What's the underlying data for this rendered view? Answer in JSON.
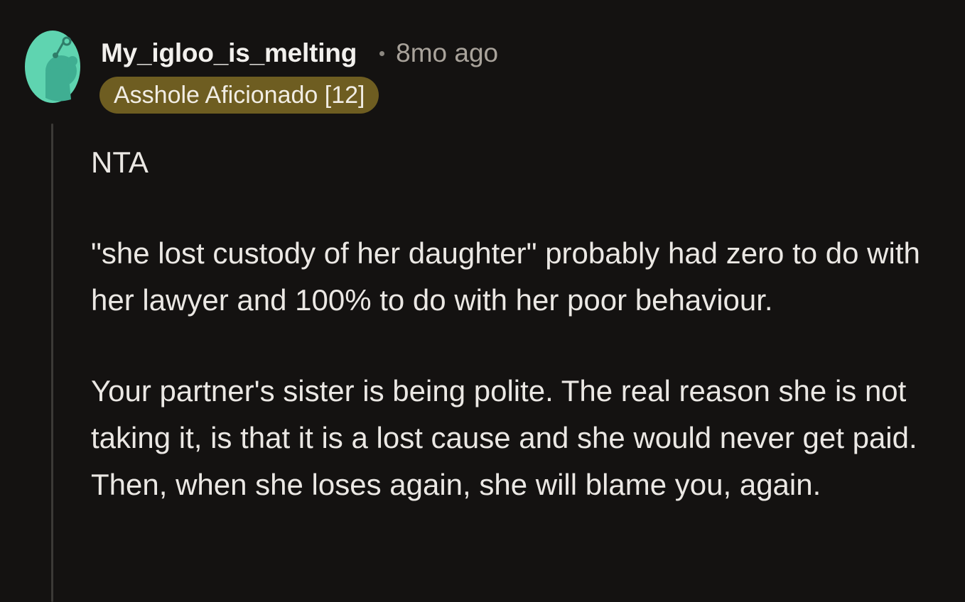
{
  "comment": {
    "username": "My_igloo_is_melting",
    "timestamp": "8mo ago",
    "flair": "Asshole Aficionado [12]",
    "paragraphs": [
      "NTA",
      "\"she lost custody of her daughter\" probably had zero to do with her lawyer and 100% to do with her poor behaviour.",
      "Your partner's sister is being polite. The real reason she is not taking it, is that it is a lost cause and she would never get paid. Then, when she loses again, she will blame you, again."
    ]
  },
  "colors": {
    "background": "#141211",
    "avatar": "#5fd4b0",
    "flair_bg": "#6e5d21",
    "thread_line": "#3b3936"
  },
  "icons": {
    "avatar": "snoo-avatar-icon"
  }
}
